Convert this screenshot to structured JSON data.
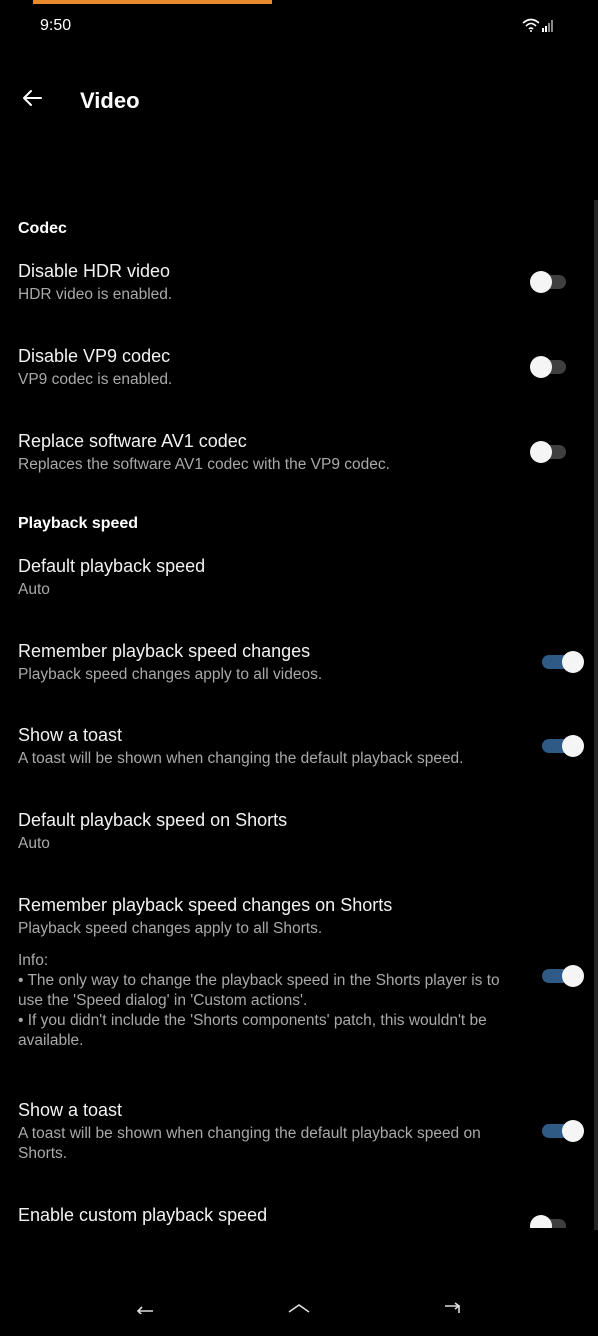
{
  "status_bar": {
    "time": "9:50"
  },
  "app_bar": {
    "title": "Video"
  },
  "colors": {
    "background": "#000000",
    "accent_bar": "#e8892b",
    "toggle_on_track": "#2f5a86",
    "toggle_off_track": "#3f3f3f",
    "summary_text": "#a9a9a9"
  },
  "sections": {
    "codec": "Codec",
    "playback_speed": "Playback speed"
  },
  "prefs": [
    {
      "title": "Disable HDR video",
      "summary": "HDR video is enabled.",
      "toggle": "off"
    },
    {
      "title": "Disable VP9 codec",
      "summary": "VP9 codec is enabled.",
      "toggle": "off"
    },
    {
      "title": "Replace software AV1 codec",
      "summary": "Replaces the software AV1 codec with the VP9 codec.",
      "toggle": "off"
    },
    {
      "title": "Default playback speed",
      "summary": "Auto"
    },
    {
      "title": "Remember playback speed changes",
      "summary": "Playback speed changes apply to all videos.",
      "toggle": "on"
    },
    {
      "title": "Show a toast",
      "summary": "A toast will be shown when changing the default playback speed.",
      "toggle": "on"
    },
    {
      "title": "Default playback speed on Shorts",
      "summary": "Auto"
    },
    {
      "title": "Remember playback speed changes on Shorts",
      "summary": "Playback speed changes apply to all Shorts.",
      "info_title": "Info:",
      "info_1": "• The only way to change the playback speed in the Shorts player is to use the 'Speed dialog' in 'Custom actions'.",
      "info_2": "• If you didn't include the 'Shorts components' patch, this wouldn't be available.",
      "toggle": "on"
    },
    {
      "title": "Show a toast",
      "summary": "A toast will be shown when changing the default playback speed on Shorts.",
      "toggle": "on"
    },
    {
      "title": "Enable custom playback speed",
      "toggle": "off"
    }
  ],
  "icons": {
    "back": "arrow-left-icon",
    "wifi": "wifi-icon",
    "signal": "signal-icon",
    "nav_back": "nav-back-icon",
    "nav_home": "nav-home-icon",
    "nav_recents": "nav-recents-icon"
  }
}
